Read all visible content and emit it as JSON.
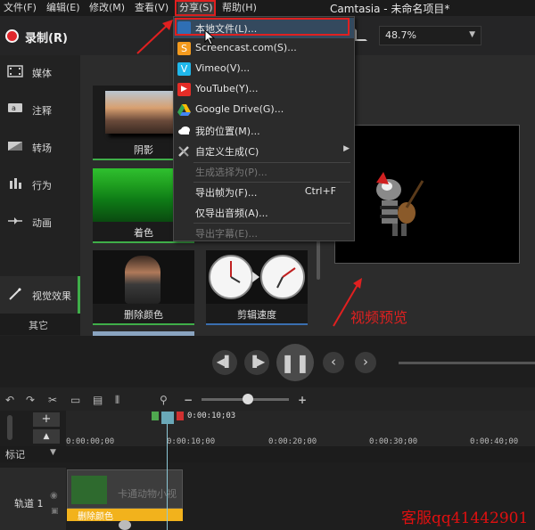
{
  "menubar": {
    "items": [
      "文件(F)",
      "编辑(E)",
      "修改(M)",
      "查看(V)",
      "分享(S)",
      "帮助(H)"
    ],
    "title": "Camtasia - 未命名项目*"
  },
  "toolbar": {
    "record_label": "录制(R)",
    "zoom": "48.7%"
  },
  "sidebar": {
    "items": [
      {
        "label": "媒体",
        "icon": "film-icon"
      },
      {
        "label": "注释",
        "icon": "annotation-icon"
      },
      {
        "label": "转场",
        "icon": "transition-icon"
      },
      {
        "label": "行为",
        "icon": "behavior-icon"
      },
      {
        "label": "动画",
        "icon": "animation-icon"
      },
      {
        "label": "视觉效果",
        "icon": "magic-wand-icon"
      }
    ],
    "other_label": "其它"
  },
  "effects": [
    {
      "label": "阴影"
    },
    {
      "label": "着色"
    },
    {
      "label": "删除颜色"
    },
    {
      "label": "剪辑速度"
    }
  ],
  "share_menu": {
    "items": [
      {
        "label": "本地文件(L)...",
        "icon": "local-file-icon",
        "color": "#2f6fb5"
      },
      {
        "label": "Screencast.com(S)...",
        "icon": "screencast-icon",
        "color": "#f39a1e"
      },
      {
        "label": "Vimeo(V)...",
        "icon": "vimeo-icon",
        "color": "#1fb7ea"
      },
      {
        "label": "YouTube(Y)...",
        "icon": "youtube-icon",
        "color": "#e52d27"
      },
      {
        "label": "Google Drive(G)...",
        "icon": "google-drive-icon",
        "color": "#34a853"
      },
      {
        "label": "我的位置(M)...",
        "icon": "cloud-icon",
        "color": "#ffffff"
      },
      {
        "label": "自定义生成(C)",
        "icon": "tools-icon",
        "color": "#cccccc"
      },
      {
        "label": "生成选择为(P)...",
        "disabled": true
      },
      {
        "label": "导出帧为(F)...",
        "shortcut": "Ctrl+F"
      },
      {
        "label": "仅导出音频(A)..."
      },
      {
        "label": "导出字幕(E)...",
        "disabled": true
      }
    ]
  },
  "preview": {
    "annotation": "视频预览"
  },
  "timeline": {
    "playhead_time": "0:00:10;03",
    "ticks": [
      "0:00:00;00",
      "0:00:10;00",
      "0:00:20;00",
      "0:00:30;00",
      "0:00:40;00"
    ],
    "marker_label": "标记",
    "track_label": "轨道 1",
    "clip_title": "卡通动物小视",
    "clip_effect": "删除颜色"
  },
  "watermark": "客服qq41442901",
  "colors": {
    "accent_green": "#3fae49",
    "record_red": "#e0262b",
    "highlight_red": "#e02020",
    "clip_yellow": "#f2b21c"
  }
}
